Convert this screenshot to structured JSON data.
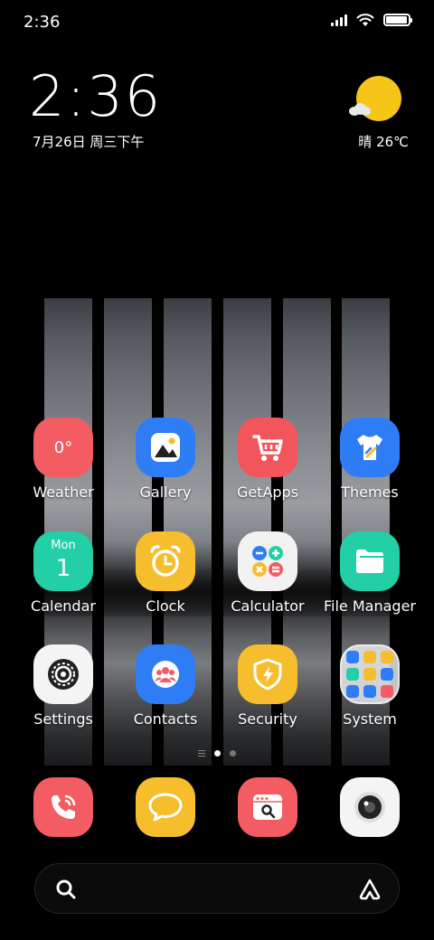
{
  "status_bar": {
    "time": "2:36",
    "icons": [
      "signal-icon",
      "wifi-icon",
      "battery-icon"
    ],
    "battery_level": 0.95
  },
  "clock_widget": {
    "time": "2:36",
    "date": "7月26日 周三下午"
  },
  "weather_widget": {
    "icon": "sun-cloud-icon",
    "text": "晴 26℃"
  },
  "apps": [
    {
      "name": "weather",
      "label": "Weather",
      "icon_text": "0°",
      "color": "#f25c62"
    },
    {
      "name": "gallery",
      "label": "Gallery",
      "color": "#2f7df5"
    },
    {
      "name": "getapps",
      "label": "GetApps",
      "color": "#f25c62"
    },
    {
      "name": "themes",
      "label": "Themes",
      "color": "#2f7df5"
    },
    {
      "name": "calendar",
      "label": "Calendar",
      "icon_day": "Mon",
      "icon_date": "1",
      "color": "#22cfa6"
    },
    {
      "name": "clock",
      "label": "Clock",
      "color": "#f6bd2d"
    },
    {
      "name": "calculator",
      "label": "Calculator",
      "color": "#f2f2f2"
    },
    {
      "name": "file-manager",
      "label": "File Manager",
      "color": "#22cfa6"
    },
    {
      "name": "settings",
      "label": "Settings",
      "color": "#f4f4f4"
    },
    {
      "name": "contacts",
      "label": "Contacts",
      "color": "#2f7df5"
    },
    {
      "name": "security",
      "label": "Security",
      "color": "#f6bd2d"
    },
    {
      "name": "system",
      "label": "System",
      "color": "#e6e6eb"
    }
  ],
  "page_indicator": {
    "pages": 2,
    "active": 1
  },
  "dock": [
    {
      "name": "phone",
      "icon": "phone-icon",
      "color": "#f25c62"
    },
    {
      "name": "messages",
      "icon": "message-bubble-icon",
      "color": "#f6bd2d"
    },
    {
      "name": "browser",
      "icon": "browser-search-icon",
      "color": "#f25c62"
    },
    {
      "name": "camera",
      "icon": "camera-lens-icon",
      "color": "#f4f4f4"
    }
  ],
  "search_bar": {
    "left_icon": "search-icon",
    "right_icon": "assistant-icon"
  }
}
